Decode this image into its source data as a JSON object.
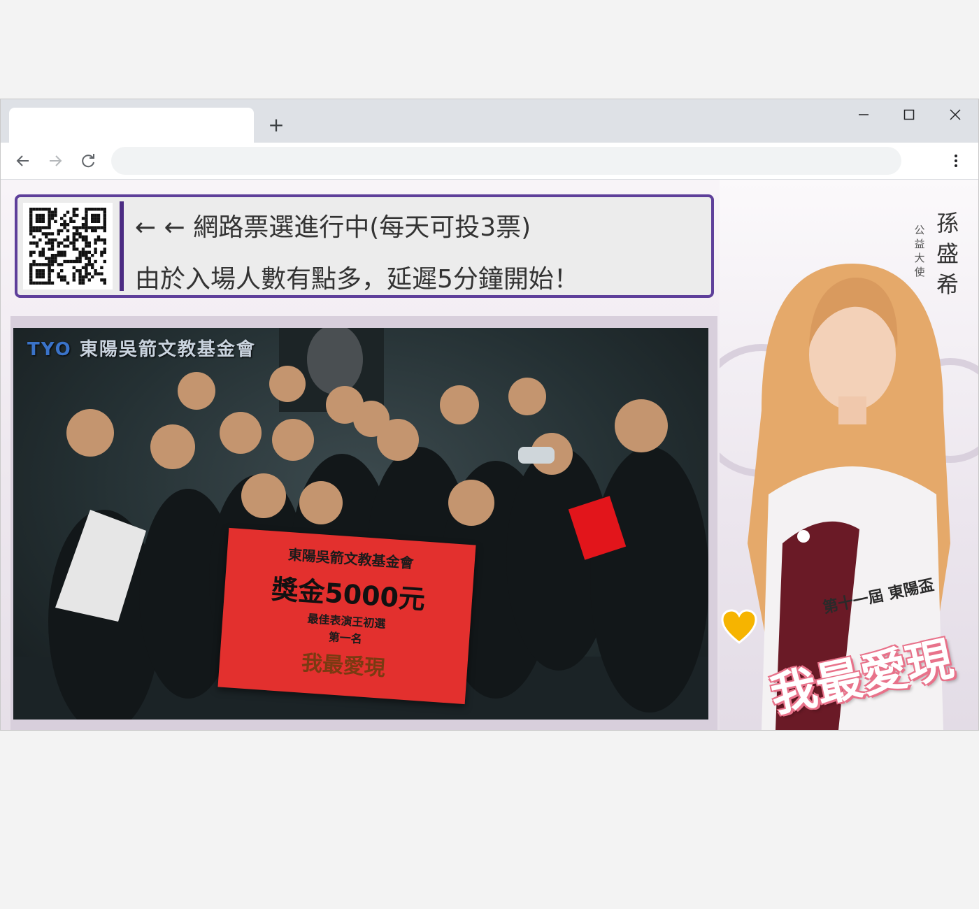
{
  "browser": {
    "new_tab_label": "+",
    "window_controls": {
      "minimize": "—",
      "maximize": "☐",
      "close": "✕"
    },
    "nav": {
      "back": "←",
      "forward": "→",
      "reload": "↻"
    },
    "address_bar": {
      "value": "",
      "placeholder": ""
    },
    "menu": "⋮"
  },
  "banner": {
    "line1": "← ←  網路票選進行中(每天可投3票)",
    "line2": "由於入場人數有點多，延遲5分鐘開始！",
    "qr_icon": "qr-code",
    "colors": {
      "border": "#5e3f9a",
      "divider": "#4c2c83"
    }
  },
  "video": {
    "logo_mark": "TYO",
    "logo_text": "東陽吳箭文教基金會",
    "sign": {
      "org": "東陽吳箭文教基金會",
      "prize": "獎金5000元",
      "award": "最佳表演王初選",
      "rank": "第一名",
      "logo": "我最愛現",
      "color": "#e3302e"
    }
  },
  "promo": {
    "name": "孫盛希",
    "role": "公益大使",
    "subtitle": "第十一屆 東陽盃",
    "title": "我最愛現",
    "colors": {
      "title_outline": "#e8728a",
      "heart": "#f6b400"
    }
  }
}
